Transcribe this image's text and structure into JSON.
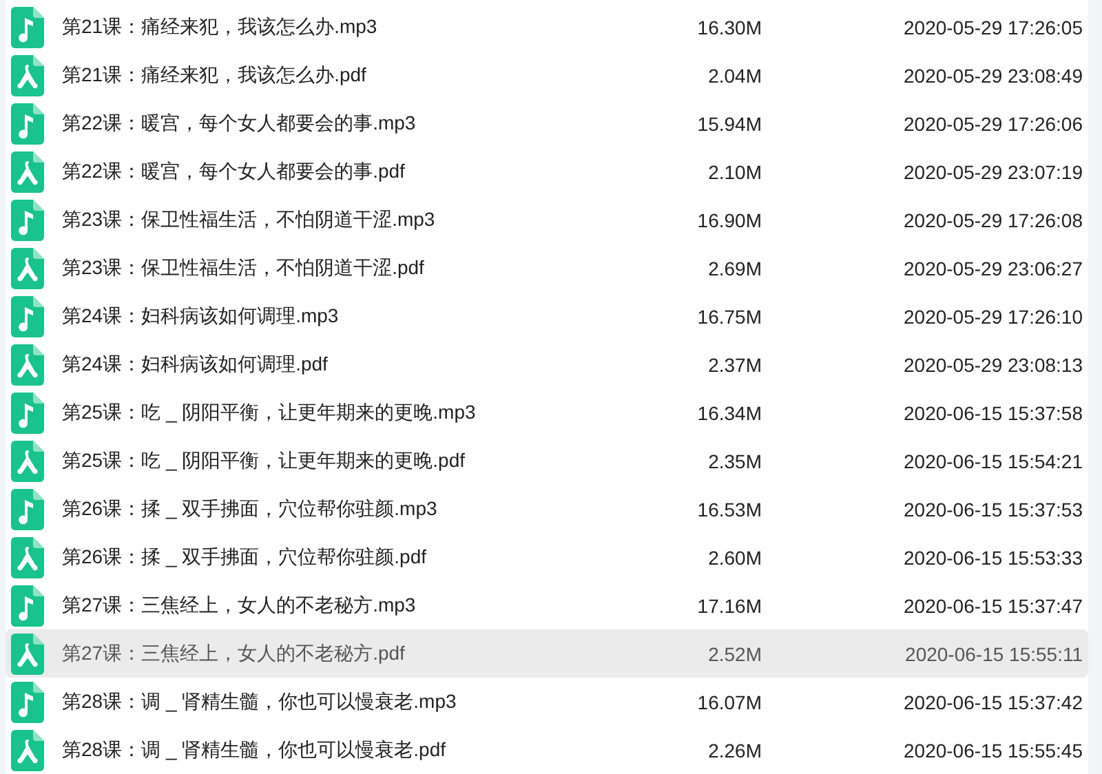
{
  "files": [
    {
      "kind": "audio",
      "name": "第21课：痛经来犯，我该怎么办.mp3",
      "size": "16.30M",
      "modified": "2020-05-29 17:26:05",
      "selected": false
    },
    {
      "kind": "pdf",
      "name": "第21课：痛经来犯，我该怎么办.pdf",
      "size": "2.04M",
      "modified": "2020-05-29 23:08:49",
      "selected": false
    },
    {
      "kind": "audio",
      "name": "第22课：暖宫，每个女人都要会的事.mp3",
      "size": "15.94M",
      "modified": "2020-05-29 17:26:06",
      "selected": false
    },
    {
      "kind": "pdf",
      "name": "第22课：暖宫，每个女人都要会的事.pdf",
      "size": "2.10M",
      "modified": "2020-05-29 23:07:19",
      "selected": false
    },
    {
      "kind": "audio",
      "name": "第23课：保卫性福生活，不怕阴道干涩.mp3",
      "size": "16.90M",
      "modified": "2020-05-29 17:26:08",
      "selected": false
    },
    {
      "kind": "pdf",
      "name": "第23课：保卫性福生活，不怕阴道干涩.pdf",
      "size": "2.69M",
      "modified": "2020-05-29 23:06:27",
      "selected": false
    },
    {
      "kind": "audio",
      "name": "第24课：妇科病该如何调理.mp3",
      "size": "16.75M",
      "modified": "2020-05-29 17:26:10",
      "selected": false
    },
    {
      "kind": "pdf",
      "name": "第24课：妇科病该如何调理.pdf",
      "size": "2.37M",
      "modified": "2020-05-29 23:08:13",
      "selected": false
    },
    {
      "kind": "audio",
      "name": "第25课：吃 _ 阴阳平衡，让更年期来的更晚.mp3",
      "size": "16.34M",
      "modified": "2020-06-15 15:37:58",
      "selected": false
    },
    {
      "kind": "pdf",
      "name": "第25课：吃 _ 阴阳平衡，让更年期来的更晚.pdf",
      "size": "2.35M",
      "modified": "2020-06-15 15:54:21",
      "selected": false
    },
    {
      "kind": "audio",
      "name": "第26课：揉 _ 双手拂面，穴位帮你驻颜.mp3",
      "size": "16.53M",
      "modified": "2020-06-15 15:37:53",
      "selected": false
    },
    {
      "kind": "pdf",
      "name": "第26课：揉 _ 双手拂面，穴位帮你驻颜.pdf",
      "size": "2.60M",
      "modified": "2020-06-15 15:53:33",
      "selected": false
    },
    {
      "kind": "audio",
      "name": "第27课：三焦经上，女人的不老秘方.mp3",
      "size": "17.16M",
      "modified": "2020-06-15 15:37:47",
      "selected": false
    },
    {
      "kind": "pdf",
      "name": "第27课：三焦经上，女人的不老秘方.pdf",
      "size": "2.52M",
      "modified": "2020-06-15 15:55:11",
      "selected": true
    },
    {
      "kind": "audio",
      "name": "第28课：调 _ 肾精生髓，你也可以慢衰老.mp3",
      "size": "16.07M",
      "modified": "2020-06-15 15:37:42",
      "selected": false
    },
    {
      "kind": "pdf",
      "name": "第28课：调 _ 肾精生髓，你也可以慢衰老.pdf",
      "size": "2.26M",
      "modified": "2020-06-15 15:55:45",
      "selected": false
    }
  ]
}
